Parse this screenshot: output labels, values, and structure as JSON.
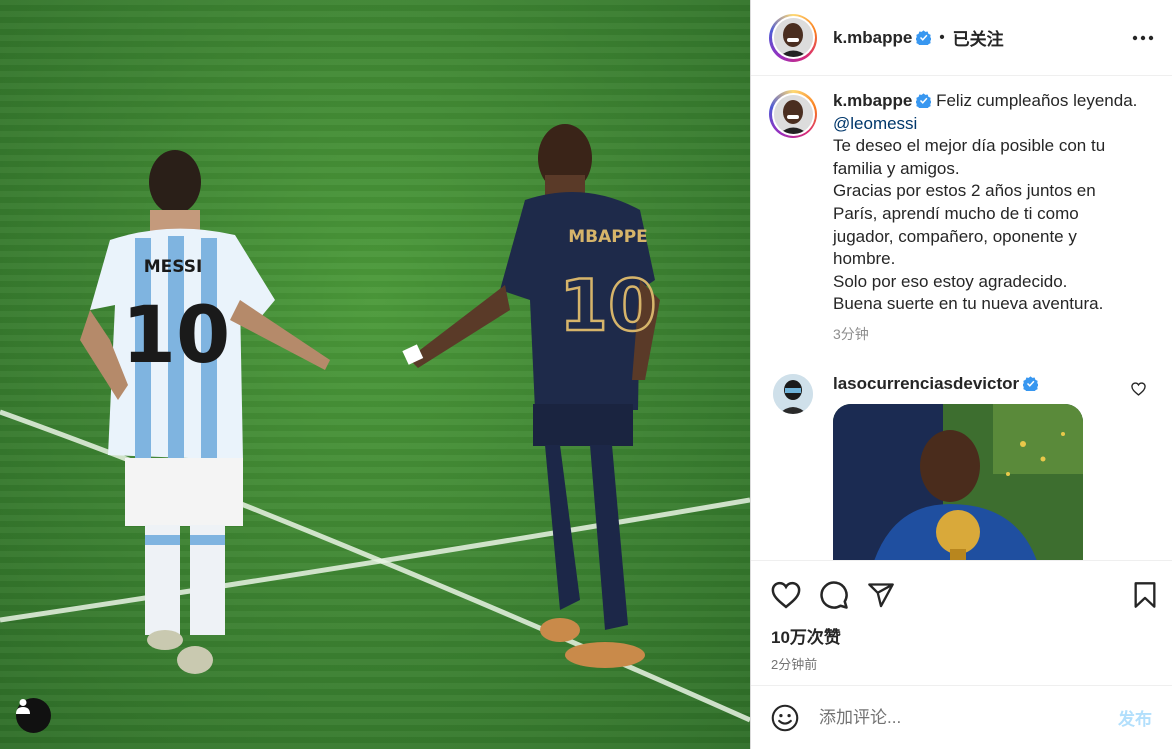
{
  "post": {
    "username": "k.mbappe",
    "follow_status": "已关注",
    "separator": "•"
  },
  "caption": {
    "username": "k.mbappe",
    "text_before_mention": "Feliz cumpleaños leyenda.",
    "mention": "@leomessi",
    "lines": [
      "Te deseo el mejor día posible con tu familia y amigos.",
      "Gracias por estos 2 años juntos en París, aprendí mucho de ti como jugador, compañero, oponente y hombre.",
      "Solo por eso estoy agradecido.",
      "Buena suerte en tu nueva aventura."
    ],
    "time": "3分钟"
  },
  "comment": {
    "username": "lasocurrenciasdevictor"
  },
  "photo": {
    "left_player_name": "MESSI",
    "left_player_number": "10",
    "right_player_name": "MBAPPE",
    "right_player_number": "10"
  },
  "stats": {
    "likes": "10万次赞",
    "posted": "2分钟前"
  },
  "comment_box": {
    "placeholder": "添加评论...",
    "post_label": "发布"
  },
  "colors": {
    "verified": "#3897f0",
    "link": "#00376b",
    "post_disabled": "#b2dffc",
    "pitch": "#3f8a34"
  },
  "icons": [
    "verified-icon",
    "more-icon",
    "heart-icon",
    "comment-icon",
    "share-icon",
    "save-icon",
    "emoji-icon",
    "user-tag-icon"
  ]
}
